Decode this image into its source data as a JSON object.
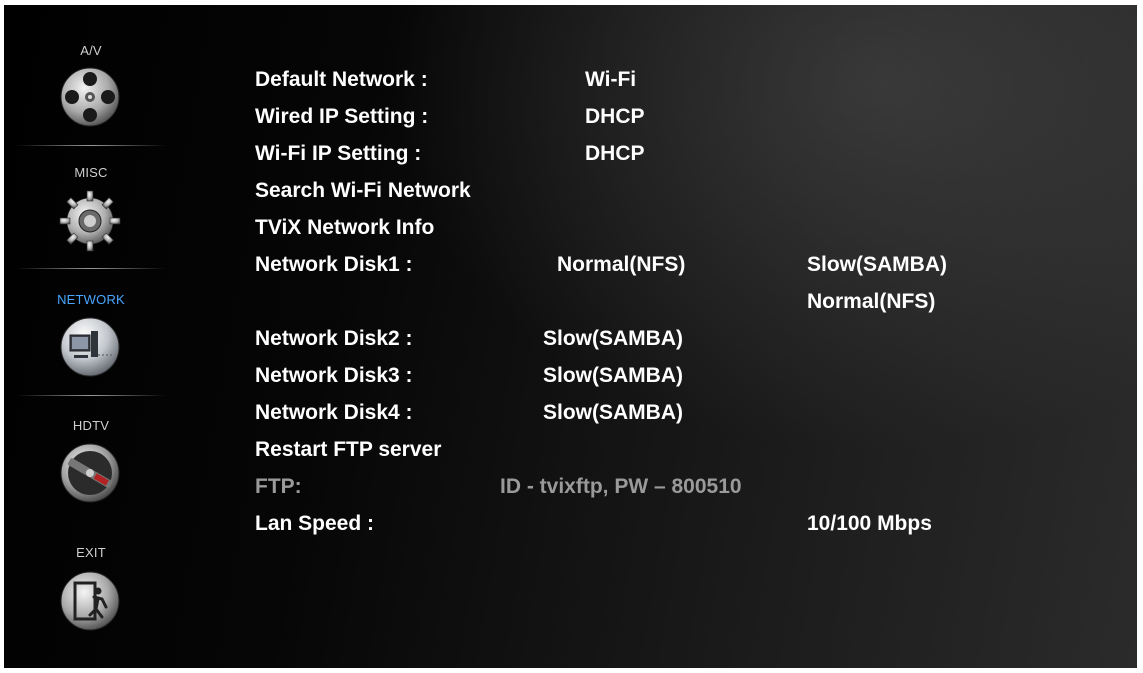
{
  "sidebar": {
    "items": [
      {
        "label": "A/V",
        "icon": "film-reel-icon",
        "active": false
      },
      {
        "label": "MISC",
        "icon": "gear-icon",
        "active": false
      },
      {
        "label": "NETWORK",
        "icon": "computer-network-icon",
        "active": true
      },
      {
        "label": "HDTV",
        "icon": "tv-dial-icon",
        "active": false
      },
      {
        "label": "EXIT",
        "icon": "exit-door-icon",
        "active": false
      }
    ],
    "active_color": "#4aa6ff"
  },
  "menu": {
    "default_network": {
      "label": "Default Network :",
      "value": "Wi-Fi"
    },
    "wired_ip": {
      "label": "Wired IP Setting :",
      "value": "DHCP"
    },
    "wifi_ip": {
      "label": "Wi-Fi IP Setting :",
      "value": "DHCP"
    },
    "search_wifi": {
      "label": "Search Wi-Fi Network"
    },
    "tvix_info": {
      "label": "TViX Network Info"
    },
    "disk1": {
      "label": "Network Disk1 :",
      "value": "Normal(NFS)",
      "options": [
        "Slow(SAMBA)",
        "Normal(NFS)"
      ]
    },
    "disk2": {
      "label": "Network Disk2 :",
      "value": "Slow(SAMBA)"
    },
    "disk3": {
      "label": "Network Disk3 :",
      "value": "Slow(SAMBA)"
    },
    "disk4": {
      "label": "Network Disk4 :",
      "value": "Slow(SAMBA)"
    },
    "restart_ftp": {
      "label": "Restart FTP server"
    },
    "ftp": {
      "label": "FTP:",
      "value": "ID - tvixftp, PW – 800510"
    },
    "lan_speed": {
      "label": "Lan Speed :",
      "value": "10/100 Mbps"
    }
  }
}
